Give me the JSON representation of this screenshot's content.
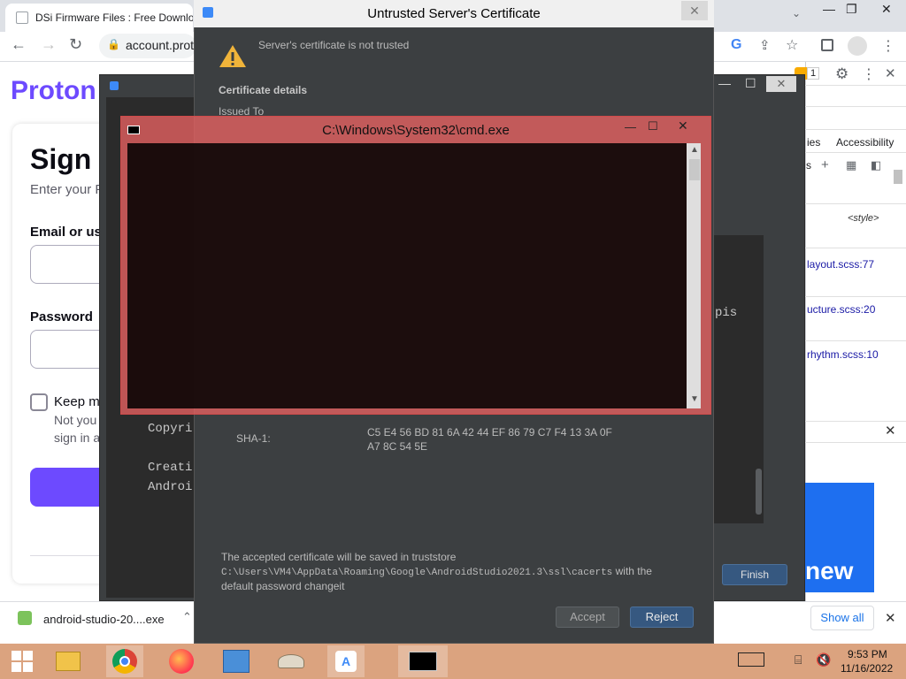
{
  "browser": {
    "tab_title": "DSi Firmware Files : Free Downlo",
    "address": "account.prot",
    "proton": {
      "logo": "Proton",
      "title": "Sign i",
      "subtitle": "Enter your P",
      "email_label": "Email or use",
      "password_label": "Password",
      "keep_label": "Keep m",
      "not_yours_1": "Not you",
      "not_yours_2": "sign in a"
    },
    "devtools": {
      "tab_1": "ies",
      "tab_2": "Accessibility",
      "style_tag": "<style>",
      "link_1": "layout.scss:77",
      "link_2": "ucture.scss:20",
      "link_3": "rhythm.scss:10",
      "promo_text": "new"
    },
    "downloads": {
      "file": "android-studio-20....exe",
      "show_all": "Show all"
    },
    "toolbar_badge": "1"
  },
  "studio_bg": {
    "console_lines": [
      "Copyri",
      "Creati",
      "Androi"
    ],
    "right_text": "pis",
    "finish_label": "Finish"
  },
  "cert_dialog": {
    "title": "Untrusted Server's Certificate",
    "warning": "Server's certificate is not trusted",
    "details_heading": "Certificate details",
    "issued_to": "Issued To",
    "sha1_label": "SHA-1:",
    "sha1_line1": "C5 E4 56 BD 81 6A 42 44 EF 86 79 C7 F4 13 3A 0F",
    "sha1_line2": "A7 8C 54 5E",
    "footer_line1": "The accepted certificate will be saved in truststore",
    "footer_path": "C:\\Users\\VM4\\AppData\\Roaming\\Google\\AndroidStudio2021.3\\ssl\\cacerts",
    "footer_with": " with the",
    "footer_line3": "default password changeit",
    "accept_label": "Accept",
    "reject_label": "Reject"
  },
  "cmd_window": {
    "title": "C:\\Windows\\System32\\cmd.exe"
  },
  "taskbar": {
    "time": "9:53 PM",
    "date": "11/16/2022"
  }
}
